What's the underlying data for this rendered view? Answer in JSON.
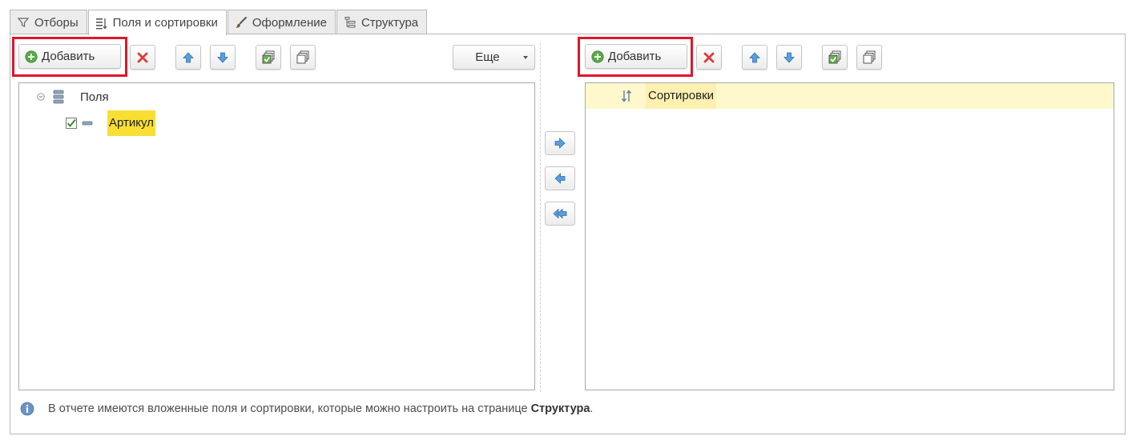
{
  "tabs": [
    {
      "label": "Отборы",
      "icon": "filter-icon",
      "active": false
    },
    {
      "label": "Поля и сортировки",
      "icon": "fields-sort-icon",
      "active": true
    },
    {
      "label": "Оформление",
      "icon": "brush-icon",
      "active": false
    },
    {
      "label": "Структура",
      "icon": "structure-icon",
      "active": false
    }
  ],
  "left_toolbar": {
    "add_label": "Добавить",
    "more_label": "Еще"
  },
  "right_toolbar": {
    "add_label": "Добавить"
  },
  "fields_tree": {
    "root_label": "Поля",
    "items": [
      {
        "label": "Артикул",
        "checked": true
      }
    ]
  },
  "sort_list": {
    "root_label": "Сортировки"
  },
  "info": {
    "text": "В отчете имеются вложенные поля и сортировки, которые можно настроить на странице ",
    "link_word": "Структура",
    "tail": "."
  },
  "colors": {
    "highlight_red": "#e0162b",
    "selected_yellow": "#f9df33",
    "row_yellow": "#fff8cc",
    "accent_blue": "#4a90d9"
  }
}
